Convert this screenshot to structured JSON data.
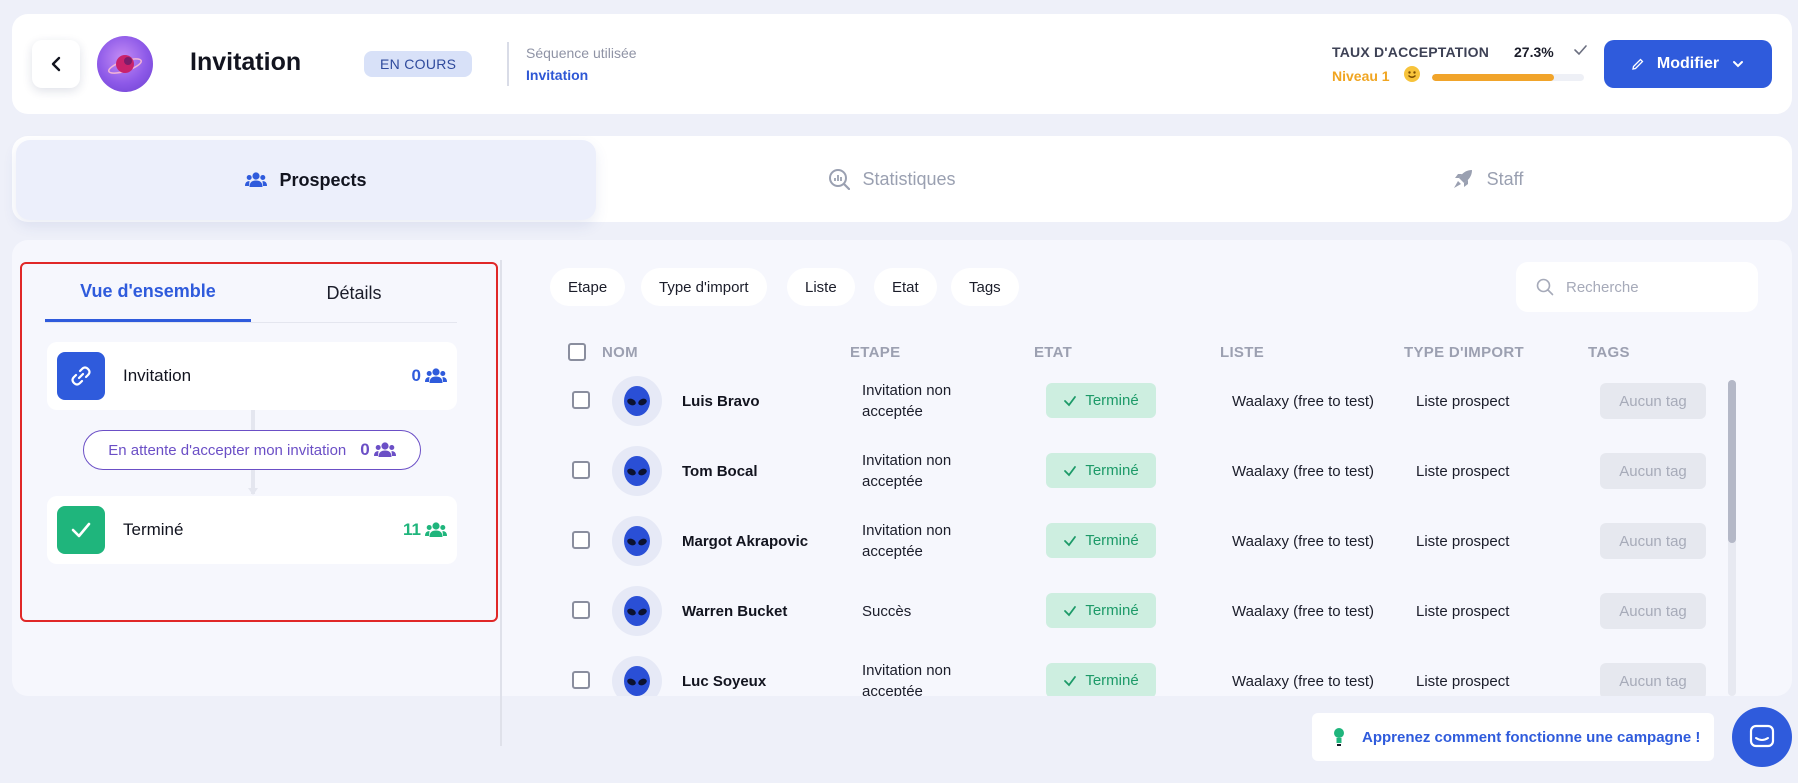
{
  "header": {
    "title": "Invitation",
    "status": "EN COURS",
    "sequence_label": "Séquence utilisée",
    "sequence_value": "Invitation",
    "acceptance_label": "TAUX D'ACCEPTATION",
    "acceptance_value": "27.3%",
    "niveau_label": "Niveau 1",
    "niveau_progress": 0.8,
    "modify_label": "Modifier"
  },
  "tabs": [
    {
      "label": "Prospects",
      "icon": "users-icon"
    },
    {
      "label": "Statistiques",
      "icon": "chart-search-icon"
    },
    {
      "label": "Staff",
      "icon": "rocket-icon"
    }
  ],
  "overview": {
    "subtabs": [
      "Vue d'ensemble",
      "Détails"
    ],
    "steps": [
      {
        "label": "Invitation",
        "count": "0",
        "color": "#2f5bdc",
        "count_color": "#2f5bdc",
        "icon": "link-icon"
      },
      {
        "label": "Terminé",
        "count": "11",
        "color": "#1fb57c",
        "count_color": "#1fb57c",
        "icon": "check-icon"
      }
    ],
    "waiting": {
      "label": "En attente d'accepter mon invitation",
      "count": "0"
    }
  },
  "filters": [
    "Etape",
    "Type d'import",
    "Liste",
    "Etat",
    "Tags"
  ],
  "search": {
    "placeholder": "Recherche"
  },
  "table": {
    "headers": [
      "NOM",
      "ETAPE",
      "ETAT",
      "LISTE",
      "TYPE D'IMPORT",
      "TAGS"
    ],
    "rows": [
      {
        "name": "Luis Bravo",
        "etape": "Invitation non acceptée",
        "etat": "Terminé",
        "liste": "Waalaxy (free to test)",
        "import": "Liste prospect",
        "tag": "Aucun tag"
      },
      {
        "name": "Tom Bocal",
        "etape": "Invitation non acceptée",
        "etat": "Terminé",
        "liste": "Waalaxy (free to test)",
        "import": "Liste prospect",
        "tag": "Aucun tag"
      },
      {
        "name": "Margot Akrapovic",
        "etape": "Invitation non acceptée",
        "etat": "Terminé",
        "liste": "Waalaxy (free to test)",
        "import": "Liste prospect",
        "tag": "Aucun tag"
      },
      {
        "name": "Warren Bucket",
        "etape": "Succès",
        "etat": "Terminé",
        "liste": "Waalaxy (free to test)",
        "import": "Liste prospect",
        "tag": "Aucun tag"
      },
      {
        "name": "Luc Soyeux",
        "etape": "Invitation non acceptée",
        "etat": "Terminé",
        "liste": "Waalaxy (free to test)",
        "import": "Liste prospect",
        "tag": "Aucun tag"
      }
    ]
  },
  "help": {
    "label": "Apprenez comment fonctionne une campagne !"
  }
}
